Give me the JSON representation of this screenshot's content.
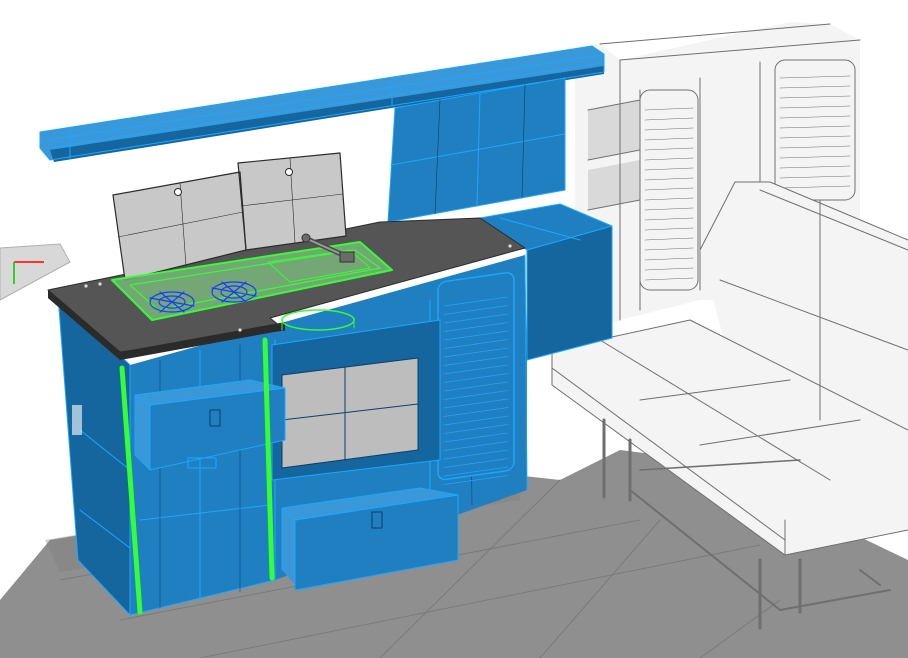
{
  "viewport": {
    "background": "#ffffff"
  },
  "colors": {
    "ground": "#8f8f8f",
    "ground_edge": "#7a7a7a",
    "object_fill": "#1f7fc0",
    "object_fill_dark": "#15669f",
    "object_fill_light": "#3a98d8",
    "selection_blue": "#1aa8ff",
    "wire_dark": "#0c3f66",
    "selection_green": "#33ff33",
    "countertop": "#555555",
    "countertop_edge": "#2b2b2b",
    "lid_panel": "#c8c8c8",
    "glass_panel": "#bdbdbd",
    "unselected_fill": "#f4f4f4",
    "unselected_wire": "#6f6f6f",
    "burner_blue": "#1a3cff",
    "axis_red": "#ff3333",
    "axis_green": "#33cc33"
  },
  "scene": {
    "objects": [
      {
        "id": "floor-plane",
        "selected": false
      },
      {
        "id": "overhead-rail",
        "selected": true,
        "highlight": "blue"
      },
      {
        "id": "wall-cabinet-door",
        "selected": true,
        "highlight": "blue"
      },
      {
        "id": "kitchen-cabinet",
        "selected": true,
        "highlight": "blue"
      },
      {
        "id": "countertop",
        "selected": false
      },
      {
        "id": "stove-lids",
        "selected": false
      },
      {
        "id": "sink-hob-unit",
        "selected": true,
        "highlight": "green"
      },
      {
        "id": "gas-burners",
        "selected": true,
        "highlight": "blue"
      },
      {
        "id": "faucet",
        "selected": false
      },
      {
        "id": "upper-drawer",
        "selected": true,
        "highlight": "blue"
      },
      {
        "id": "lower-drawer",
        "selected": true,
        "highlight": "blue"
      },
      {
        "id": "oven-glass-door",
        "selected": false
      },
      {
        "id": "vent-grille",
        "selected": true,
        "highlight": "blue"
      },
      {
        "id": "side-tower-cabinet",
        "selected": true,
        "highlight": "blue"
      },
      {
        "id": "cabinet-edge-profile",
        "selected": true,
        "highlight": "green"
      },
      {
        "id": "rear-shelving-unit",
        "selected": false
      },
      {
        "id": "bench-seat",
        "selected": false
      },
      {
        "id": "bench-frame",
        "selected": false
      }
    ]
  }
}
